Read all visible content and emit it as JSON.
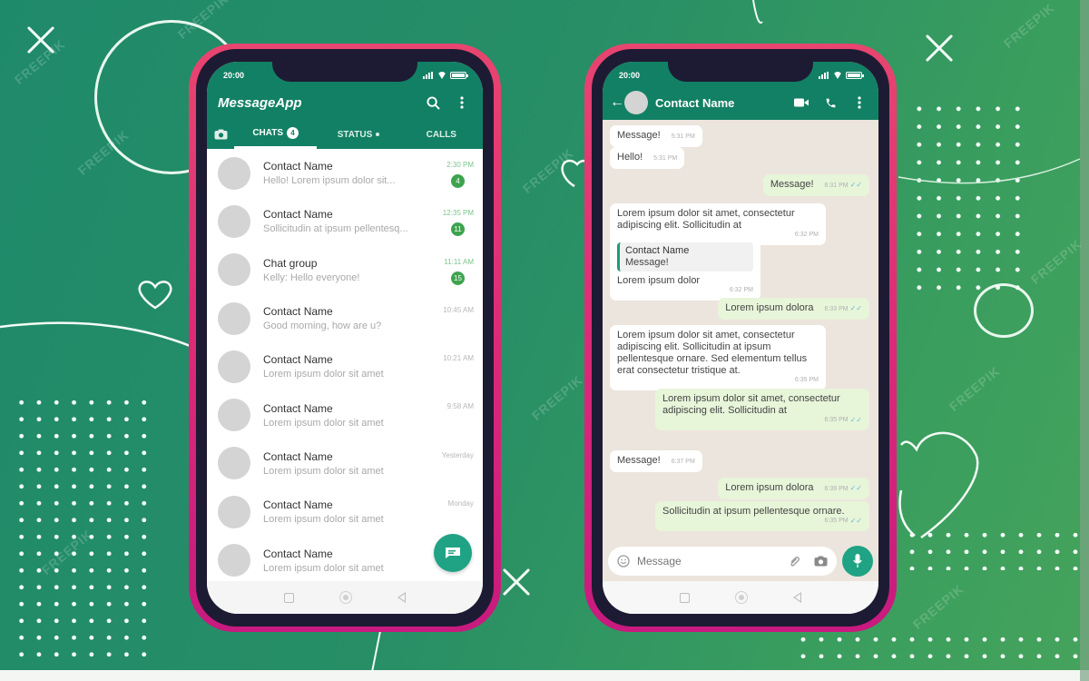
{
  "background": {
    "color_start": "#1f8a6a",
    "color_end": "#45a35c",
    "watermark": "FREEPIK"
  },
  "phone_frame_color": "#dd2a78",
  "left_phone": {
    "status_time": "20:00",
    "app_title": "MessageApp",
    "header_color": "#128064",
    "tabs": [
      {
        "label": "CHATS",
        "badge": "4",
        "active": true
      },
      {
        "label": "STATUS",
        "dot": true
      },
      {
        "label": "CALLS"
      }
    ],
    "chats": [
      {
        "name": "Contact Name",
        "preview": "Hello! Lorem ipsum dolor sit...",
        "time": "2:30 PM",
        "unread": "4"
      },
      {
        "name": "Contact Name",
        "preview": "Sollicitudin at ipsum pellentesq...",
        "time": "12:35 PM",
        "unread": "11"
      },
      {
        "name": "Chat group",
        "preview": "Kelly: Hello everyone!",
        "time": "11:11 AM",
        "unread": "15"
      },
      {
        "name": "Contact Name",
        "preview": "Good morning, how are u?",
        "time": "10:45 AM"
      },
      {
        "name": "Contact Name",
        "preview": "Lorem ipsum dolor sit amet",
        "time": "10:21 AM"
      },
      {
        "name": "Contact Name",
        "preview": "Lorem ipsum dolor sit amet",
        "time": "9:58 AM"
      },
      {
        "name": "Contact Name",
        "preview": "Lorem ipsum dolor sit amet",
        "time": "Yesterday"
      },
      {
        "name": "Contact Name",
        "preview": "Lorem ipsum dolor sit amet",
        "time": "Monday"
      },
      {
        "name": "Contact Name",
        "preview": "Lorem ipsum dolor sit amet",
        "time": ""
      }
    ]
  },
  "right_phone": {
    "status_time": "20:00",
    "contact_name": "Contact Name",
    "messages": [
      {
        "dir": "in",
        "text": "Message!",
        "time": "5:31 PM"
      },
      {
        "dir": "in",
        "text": "Hello!",
        "time": "5:31 PM"
      },
      {
        "dir": "out",
        "text": "Message!",
        "time": "6:31 PM",
        "read": "✓✓"
      },
      {
        "dir": "in",
        "text": "Lorem ipsum dolor sit amet, consectetur adipiscing elit. Sollicitudin at",
        "time": "6:32 PM"
      },
      {
        "dir": "in",
        "quote_name": "Contact Name",
        "quote_text": "Message!",
        "text": "Lorem ipsum dolor",
        "time": "6:32 PM"
      },
      {
        "dir": "out",
        "text": "Lorem ipsum dolora",
        "time": "6:33 PM",
        "read": "✓✓"
      },
      {
        "dir": "in",
        "text": "Lorem ipsum dolor sit amet, consectetur adipiscing elit. Sollicitudin at ipsum pellentesque ornare. Sed elementum tellus erat consectetur tristique at.",
        "time": "6:35 PM"
      },
      {
        "dir": "out",
        "text": "Lorem ipsum dolor sit amet, consectetur adipiscing elit. Sollicitudin at",
        "time": "6:35 PM",
        "read": "✓✓"
      },
      {
        "dir": "in",
        "text": "Message!",
        "time": "6:37 PM"
      },
      {
        "dir": "out",
        "text": "Lorem ipsum dolora",
        "time": "6:39 PM",
        "read": "✓✓"
      },
      {
        "dir": "out",
        "text": "Sollicitudin at ipsum pellentesque ornare.",
        "time": "6:35 PM",
        "read": "✓✓"
      }
    ],
    "composer_placeholder": "Message"
  }
}
